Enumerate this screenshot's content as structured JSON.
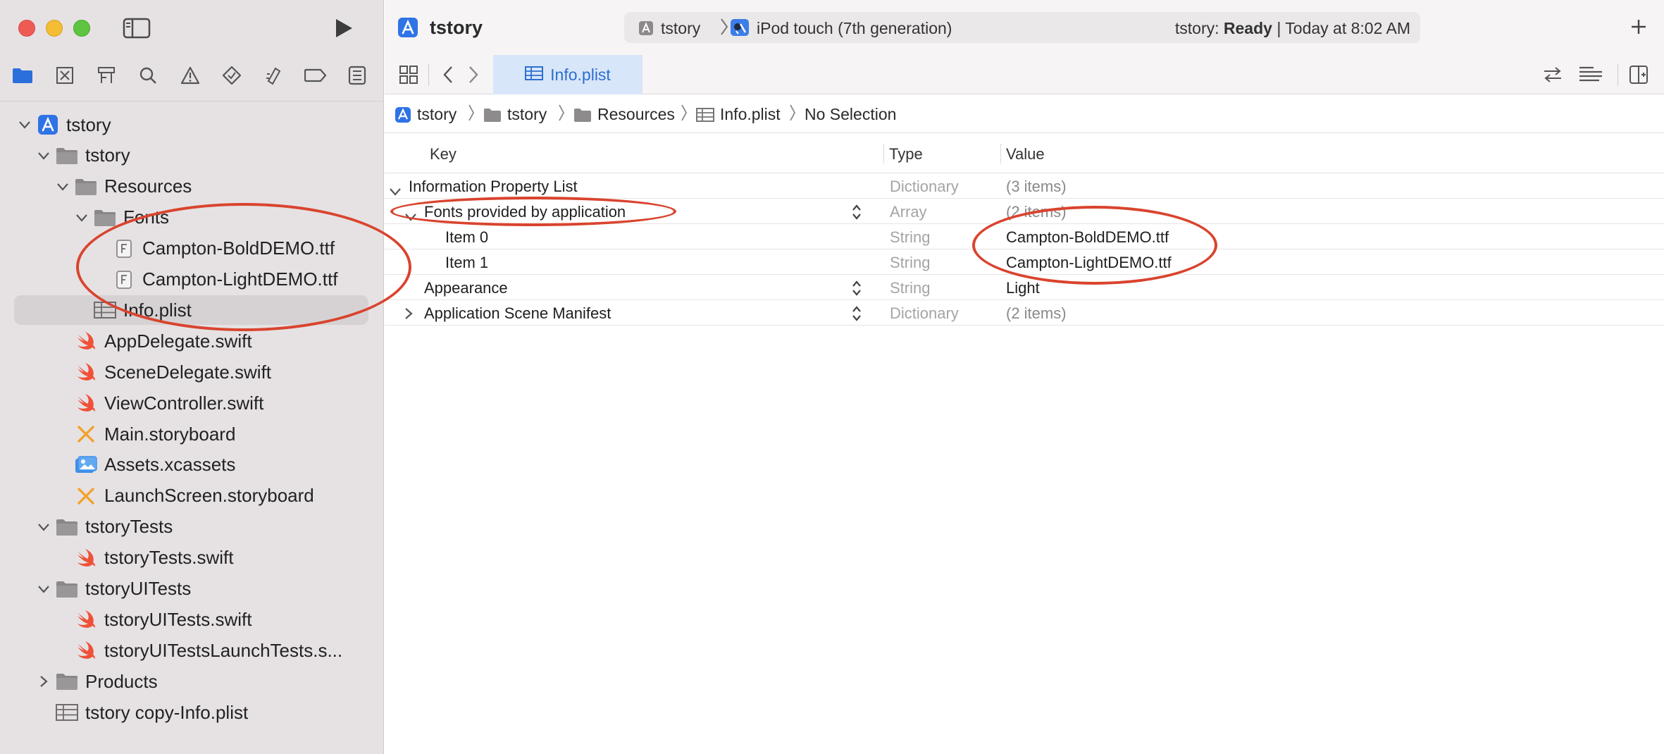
{
  "window": {
    "project_title": "tstory",
    "scheme": "tstory",
    "device": "iPod touch (7th generation)",
    "status_prefix": "tstory: ",
    "status_state": "Ready",
    "status_suffix": " | Today at 8:02 AM"
  },
  "navigator": {
    "tabs": [
      "folder-icon",
      "source-control-icon",
      "symbol-icon",
      "find-icon",
      "issue-icon",
      "test-icon",
      "debug-icon",
      "breakpoint-icon",
      "report-icon"
    ],
    "items": [
      {
        "label": "tstory",
        "icon": "project-icon",
        "depth": 0,
        "disclosure": "open"
      },
      {
        "label": "tstory",
        "icon": "folder-icon",
        "depth": 1,
        "disclosure": "open"
      },
      {
        "label": "Resources",
        "icon": "folder-icon",
        "depth": 2,
        "disclosure": "open"
      },
      {
        "label": "Fonts",
        "icon": "folder-icon",
        "depth": 3,
        "disclosure": "open"
      },
      {
        "label": "Campton-BoldDEMO.ttf",
        "icon": "font-file-icon",
        "depth": 4,
        "disclosure": "none"
      },
      {
        "label": "Campton-LightDEMO.ttf",
        "icon": "font-file-icon",
        "depth": 4,
        "disclosure": "none"
      },
      {
        "label": "Info.plist",
        "icon": "plist-icon",
        "depth": 3,
        "disclosure": "none",
        "selected": true
      },
      {
        "label": "AppDelegate.swift",
        "icon": "swift-icon",
        "depth": 2,
        "disclosure": "none"
      },
      {
        "label": "SceneDelegate.swift",
        "icon": "swift-icon",
        "depth": 2,
        "disclosure": "none"
      },
      {
        "label": "ViewController.swift",
        "icon": "swift-icon",
        "depth": 2,
        "disclosure": "none"
      },
      {
        "label": "Main.storyboard",
        "icon": "storyboard-icon",
        "depth": 2,
        "disclosure": "none"
      },
      {
        "label": "Assets.xcassets",
        "icon": "assets-icon",
        "depth": 2,
        "disclosure": "none"
      },
      {
        "label": "LaunchScreen.storyboard",
        "icon": "storyboard-icon",
        "depth": 2,
        "disclosure": "none"
      },
      {
        "label": "tstoryTests",
        "icon": "folder-icon",
        "depth": 1,
        "disclosure": "open"
      },
      {
        "label": "tstoryTests.swift",
        "icon": "swift-icon",
        "depth": 2,
        "disclosure": "none"
      },
      {
        "label": "tstoryUITests",
        "icon": "folder-icon",
        "depth": 1,
        "disclosure": "open"
      },
      {
        "label": "tstoryUITests.swift",
        "icon": "swift-icon",
        "depth": 2,
        "disclosure": "none"
      },
      {
        "label": "tstoryUITestsLaunchTests.s...",
        "icon": "swift-icon",
        "depth": 2,
        "disclosure": "none"
      },
      {
        "label": "Products",
        "icon": "folder-icon",
        "depth": 1,
        "disclosure": "closed"
      },
      {
        "label": "tstory copy-Info.plist",
        "icon": "plist-icon",
        "depth": 1,
        "disclosure": "none"
      }
    ]
  },
  "editor": {
    "active_tab": "Info.plist",
    "breadcrumbs": [
      "tstory",
      "tstory",
      "Resources",
      "Info.plist",
      "No Selection"
    ],
    "columns": {
      "key": "Key",
      "type": "Type",
      "value": "Value"
    },
    "rows": [
      {
        "key": "Information Property List",
        "type": "Dictionary",
        "value": "(3 items)",
        "indent": 0,
        "disclosure": "open",
        "stepper": false,
        "value_muted": true
      },
      {
        "key": "Fonts provided by application",
        "type": "Array",
        "value": "(2 items)",
        "indent": 1,
        "disclosure": "open",
        "stepper": true,
        "value_muted": true
      },
      {
        "key": "Item 0",
        "type": "String",
        "value": "Campton-BoldDEMO.ttf",
        "indent": 2,
        "disclosure": "none",
        "stepper": false,
        "value_muted": false
      },
      {
        "key": "Item 1",
        "type": "String",
        "value": "Campton-LightDEMO.ttf",
        "indent": 2,
        "disclosure": "none",
        "stepper": false,
        "value_muted": false
      },
      {
        "key": "Appearance",
        "type": "String",
        "value": "Light",
        "indent": 1,
        "disclosure": "none",
        "stepper": true,
        "value_muted": false
      },
      {
        "key": "Application Scene Manifest",
        "type": "Dictionary",
        "value": "(2 items)",
        "indent": 1,
        "disclosure": "closed",
        "stepper": true,
        "value_muted": true
      }
    ]
  },
  "colors": {
    "accent": "#2c6fd0",
    "annotation": "#d9442e",
    "swift": "#f05138",
    "storyboard": "#f2a22d"
  }
}
